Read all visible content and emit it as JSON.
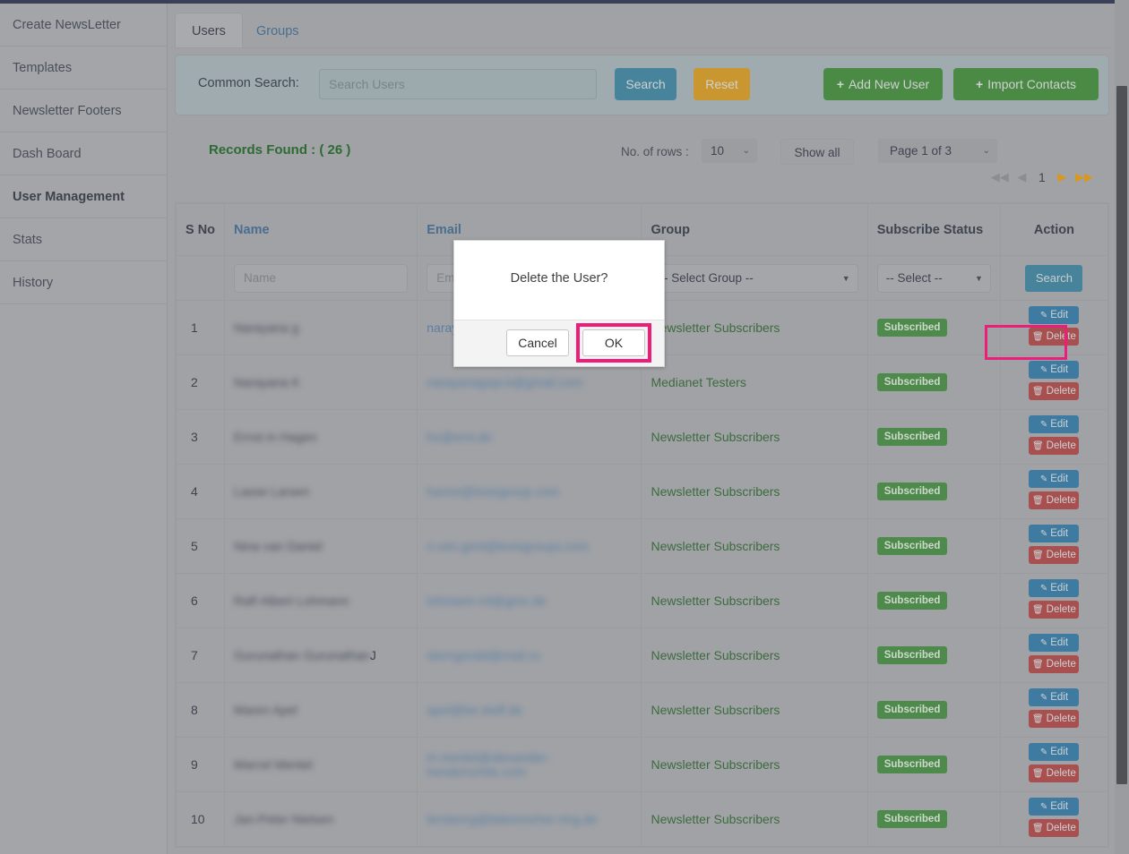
{
  "sidebar": {
    "items": [
      {
        "label": "Create NewsLetter",
        "active": false
      },
      {
        "label": "Templates",
        "active": false
      },
      {
        "label": "Newsletter Footers",
        "active": false
      },
      {
        "label": "Dash Board",
        "active": false
      },
      {
        "label": "User Management",
        "active": true
      },
      {
        "label": "Stats",
        "active": false
      },
      {
        "label": "History",
        "active": false
      }
    ]
  },
  "tabs": [
    {
      "label": "Users",
      "active": true
    },
    {
      "label": "Groups",
      "active": false
    }
  ],
  "search_panel": {
    "label": "Common Search:",
    "input_placeholder": "Search Users",
    "input_value": "",
    "search_label": "Search",
    "reset_label": "Reset",
    "add_user_label": "Add New User",
    "import_contacts_label": "Import Contacts",
    "plus_icon": "+"
  },
  "toolbar": {
    "records_found": "Records Found : ( 26 )",
    "rows_label": "No. of rows  :",
    "rows_value": "10",
    "show_all_label": "Show all",
    "page_value": "Page 1 of 3",
    "chevron": "⌄",
    "pager": {
      "first": "◀◀",
      "prev": "◀",
      "current": "1",
      "next": "▶",
      "last": "▶▶"
    }
  },
  "table": {
    "headers": {
      "sno": "S No",
      "name": "Name",
      "email": "Email",
      "group": "Group",
      "status": "Subscribe Status",
      "action": "Action"
    },
    "filters": {
      "name_placeholder": "Name",
      "email_placeholder": "Email",
      "group_value": "-- Select Group --",
      "status_value": "-- Select --",
      "search_label": "Search",
      "arrow": "▼"
    },
    "row_actions": {
      "edit_label": "Edit",
      "delete_label": "Delete",
      "edit_icon": "✎",
      "delete_icon": "Ὕ1"
    },
    "rows": [
      {
        "sno": "1",
        "name": "Narayana g",
        "email": "narayana@example.com",
        "email_visible_prefix": "naraya",
        "group": "Newsletter Subscribers",
        "status": "Subscribed",
        "redacted": true
      },
      {
        "sno": "2",
        "name": "Narayana K",
        "email": "narayanagopi.k@gmail.com",
        "group": "Medianet Testers",
        "status": "Subscribed",
        "redacted": true
      },
      {
        "sno": "3",
        "name": "Ernst in  Hagen",
        "email": "ho@erst.de",
        "group": "Newsletter Subscribers",
        "status": "Subscribed",
        "redacted": true
      },
      {
        "sno": "4",
        "name": "Lasse Larsen",
        "email": "hanne@lexisgroup.com",
        "group": "Newsletter Subscribers",
        "status": "Subscribed",
        "redacted": true
      },
      {
        "sno": "5",
        "name": "Nina van Daniel",
        "email": "n.van.gent@lexisgroups.com",
        "group": "Newsletter Subscribers",
        "status": "Subscribed",
        "redacted": true
      },
      {
        "sno": "6",
        "name": "Ralf-Albert Lohmann",
        "email": "lohmann-ml@gmx.de",
        "group": "Newsletter Subscribers",
        "status": "Subscribed",
        "redacted": true
      },
      {
        "sno": "7",
        "name": "Gurunathan Gurunathan",
        "email": "sterngerald@mail.ru",
        "group": "Newsletter Subscribers",
        "status": "Subscribed",
        "redacted": true,
        "suffix": "J"
      },
      {
        "sno": "8",
        "name": "Maren Apel",
        "email": "apel@be-stoff.de",
        "group": "Newsletter Subscribers",
        "status": "Subscribed",
        "redacted": true
      },
      {
        "sno": "9",
        "name": "Marcel Mentel",
        "email": "m.mentel@alexander-henderschite.com",
        "group": "Newsletter Subscribers",
        "status": "Subscribed",
        "redacted": true
      },
      {
        "sno": "10",
        "name": "Jan-Peter Nielsen",
        "email": "ferstenrg@bekenncher-ring.de",
        "group": "Newsletter Subscribers",
        "status": "Subscribed",
        "redacted": true
      }
    ]
  },
  "modal": {
    "message": "Delete the User?",
    "cancel_label": "Cancel",
    "ok_label": "OK"
  },
  "colors": {
    "accent_blue": "#47849c",
    "reset_orange": "#c9962f",
    "green": "#4a8a44",
    "records_green": "#2d6b33",
    "highlight_pink": "#ec1e79",
    "edit_blue": "#3f7ba1",
    "delete_red": "#a85050",
    "topbar_navy": "#3a4157"
  }
}
